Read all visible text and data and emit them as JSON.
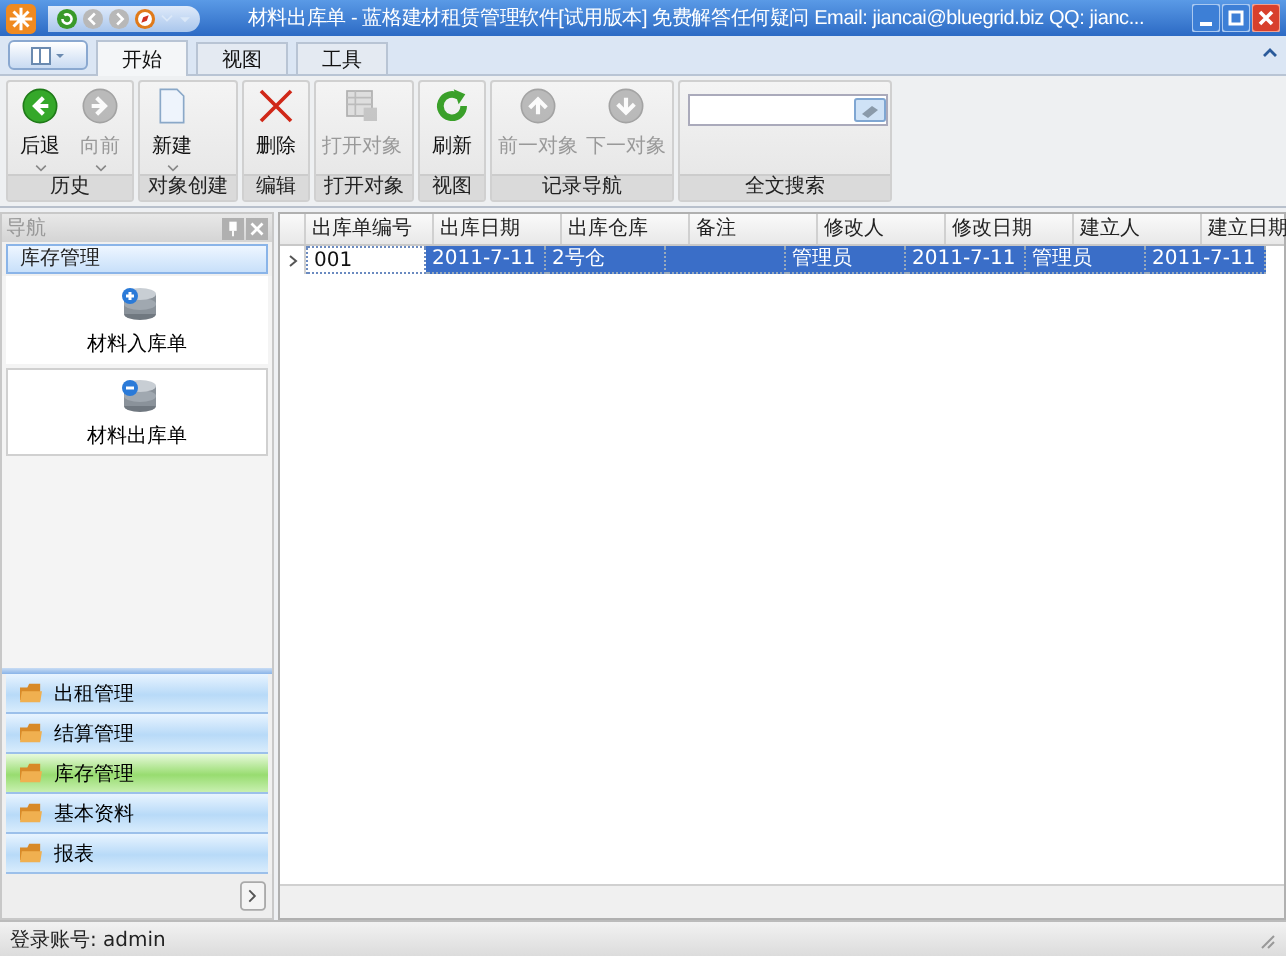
{
  "window": {
    "title": "材料出库单 - 蓝格建材租赁管理软件[试用版本] 免费解答任何疑问 Email: jiancai@bluegrid.biz QQ: jianc..."
  },
  "ribbon_tabs": [
    {
      "label": "开始",
      "selected": true
    },
    {
      "label": "视图",
      "selected": false
    },
    {
      "label": "工具",
      "selected": false
    }
  ],
  "ribbon_groups": [
    {
      "label": "历史",
      "kind": "buttons",
      "buttons": [
        {
          "label": "后退",
          "kind": "back",
          "disabled": false,
          "dropdown": true
        },
        {
          "label": "向前",
          "kind": "forward",
          "disabled": true,
          "dropdown": true
        }
      ]
    },
    {
      "label": "对象创建",
      "kind": "buttons",
      "buttons": [
        {
          "label": "新建",
          "kind": "new",
          "disabled": false,
          "dropdown": true
        }
      ]
    },
    {
      "label": "编辑",
      "kind": "buttons",
      "buttons": [
        {
          "label": "删除",
          "kind": "delete",
          "disabled": false,
          "dropdown": false
        }
      ]
    },
    {
      "label": "打开对象",
      "kind": "buttons",
      "buttons": [
        {
          "label": "打开对象",
          "kind": "open",
          "disabled": true,
          "dropdown": false
        }
      ]
    },
    {
      "label": "视图",
      "kind": "buttons",
      "buttons": [
        {
          "label": "刷新",
          "kind": "refresh",
          "disabled": false,
          "dropdown": false
        }
      ]
    },
    {
      "label": "记录导航",
      "kind": "buttons",
      "buttons": [
        {
          "label": "前一对象",
          "kind": "up",
          "disabled": true,
          "dropdown": false
        },
        {
          "label": "下一对象",
          "kind": "down",
          "disabled": true,
          "dropdown": false
        }
      ]
    },
    {
      "label": "全文搜索",
      "kind": "search"
    }
  ],
  "navigation": {
    "title": "导航",
    "group_title": "库存管理",
    "items": [
      {
        "label": "材料入库单",
        "kind": "in",
        "selected": false
      },
      {
        "label": "材料出库单",
        "kind": "out",
        "selected": true
      }
    ],
    "groups": [
      {
        "label": "出租管理",
        "selected": false
      },
      {
        "label": "结算管理",
        "selected": false
      },
      {
        "label": "库存管理",
        "selected": true
      },
      {
        "label": "基本资料",
        "selected": false
      },
      {
        "label": "报表",
        "selected": false
      }
    ]
  },
  "table": {
    "columns": [
      "出库单编号",
      "出库日期",
      "出库仓库",
      "备注",
      "修改人",
      "修改日期",
      "建立人",
      "建立日期"
    ],
    "rows": [
      {
        "selected": true,
        "cells": [
          {
            "text": "001",
            "focused": true
          },
          {
            "text": "2011-7-11",
            "focused": false
          },
          {
            "text": "2号仓",
            "focused": false
          },
          {
            "focused": false
          },
          {
            "text": "管理员",
            "focused": false
          },
          {
            "text": "2011-7-11",
            "focused": false
          },
          {
            "text": "管理员",
            "focused": false
          },
          {
            "text": "2011-7-11",
            "focused": false
          }
        ]
      }
    ]
  },
  "status_bar": {
    "text": "登录账号: admin"
  }
}
